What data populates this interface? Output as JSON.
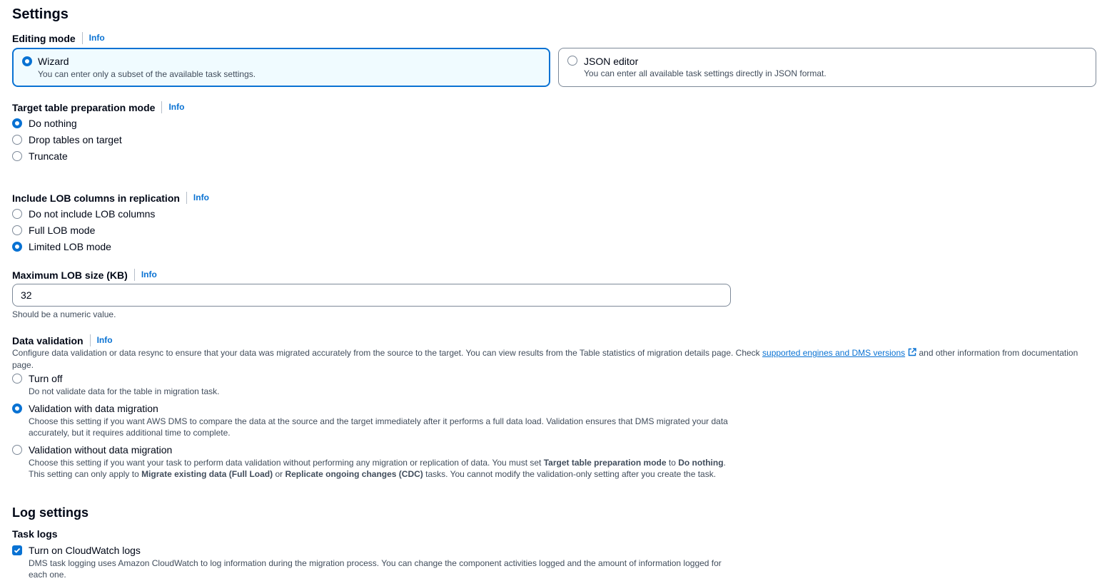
{
  "settings": {
    "title": "Settings",
    "editing_mode": {
      "label": "Editing mode",
      "info": "Info",
      "wizard": {
        "title": "Wizard",
        "desc": "You can enter only a subset of the available task settings."
      },
      "json": {
        "title": "JSON editor",
        "desc": "You can enter all available task settings directly in JSON format."
      }
    },
    "target_prep": {
      "label": "Target table preparation mode",
      "info": "Info",
      "options": [
        "Do nothing",
        "Drop tables on target",
        "Truncate"
      ]
    },
    "lob": {
      "label": "Include LOB columns in replication",
      "info": "Info",
      "options": [
        "Do not include LOB columns",
        "Full LOB mode",
        "Limited LOB mode"
      ]
    },
    "max_lob": {
      "label": "Maximum LOB size (KB)",
      "info": "Info",
      "value": "32",
      "hint": "Should be a numeric value."
    },
    "validation": {
      "label": "Data validation",
      "info": "Info",
      "desc_pre": "Configure data validation or data resync to ensure that your data was migrated accurately from the source to the target. You can view results from the Table statistics of migration details page. Check ",
      "desc_link": "supported engines and DMS versions",
      "desc_post": " and other information from documentation page.",
      "turn_off": {
        "title": "Turn off",
        "desc": "Do not validate data for the table in migration task."
      },
      "with_migration": {
        "title": "Validation with data migration",
        "desc": "Choose this setting if you want AWS DMS to compare the data at the source and the target immediately after it performs a full data load. Validation ensures that DMS migrated your data accurately, but it requires additional time to complete."
      },
      "without_migration": {
        "title": "Validation without data migration",
        "d1": "Choose this setting if you want your task to perform data validation without performing any migration or replication of data. You must set ",
        "b1": "Target table preparation mode",
        "d2": " to ",
        "b2": "Do nothing",
        "d3": ". This setting can only apply to ",
        "b3": "Migrate existing data (Full Load)",
        "d4": " or ",
        "b4": "Replicate ongoing changes (CDC)",
        "d5": " tasks. You cannot modify the validation-only setting after you create the task."
      }
    }
  },
  "log_settings": {
    "title": "Log settings",
    "task_logs": "Task logs",
    "cloudwatch": {
      "title": "Turn on CloudWatch logs",
      "desc": "DMS task logging uses Amazon CloudWatch to log information during the migration process. You can change the component activities logged and the amount of information logged for each one."
    }
  }
}
